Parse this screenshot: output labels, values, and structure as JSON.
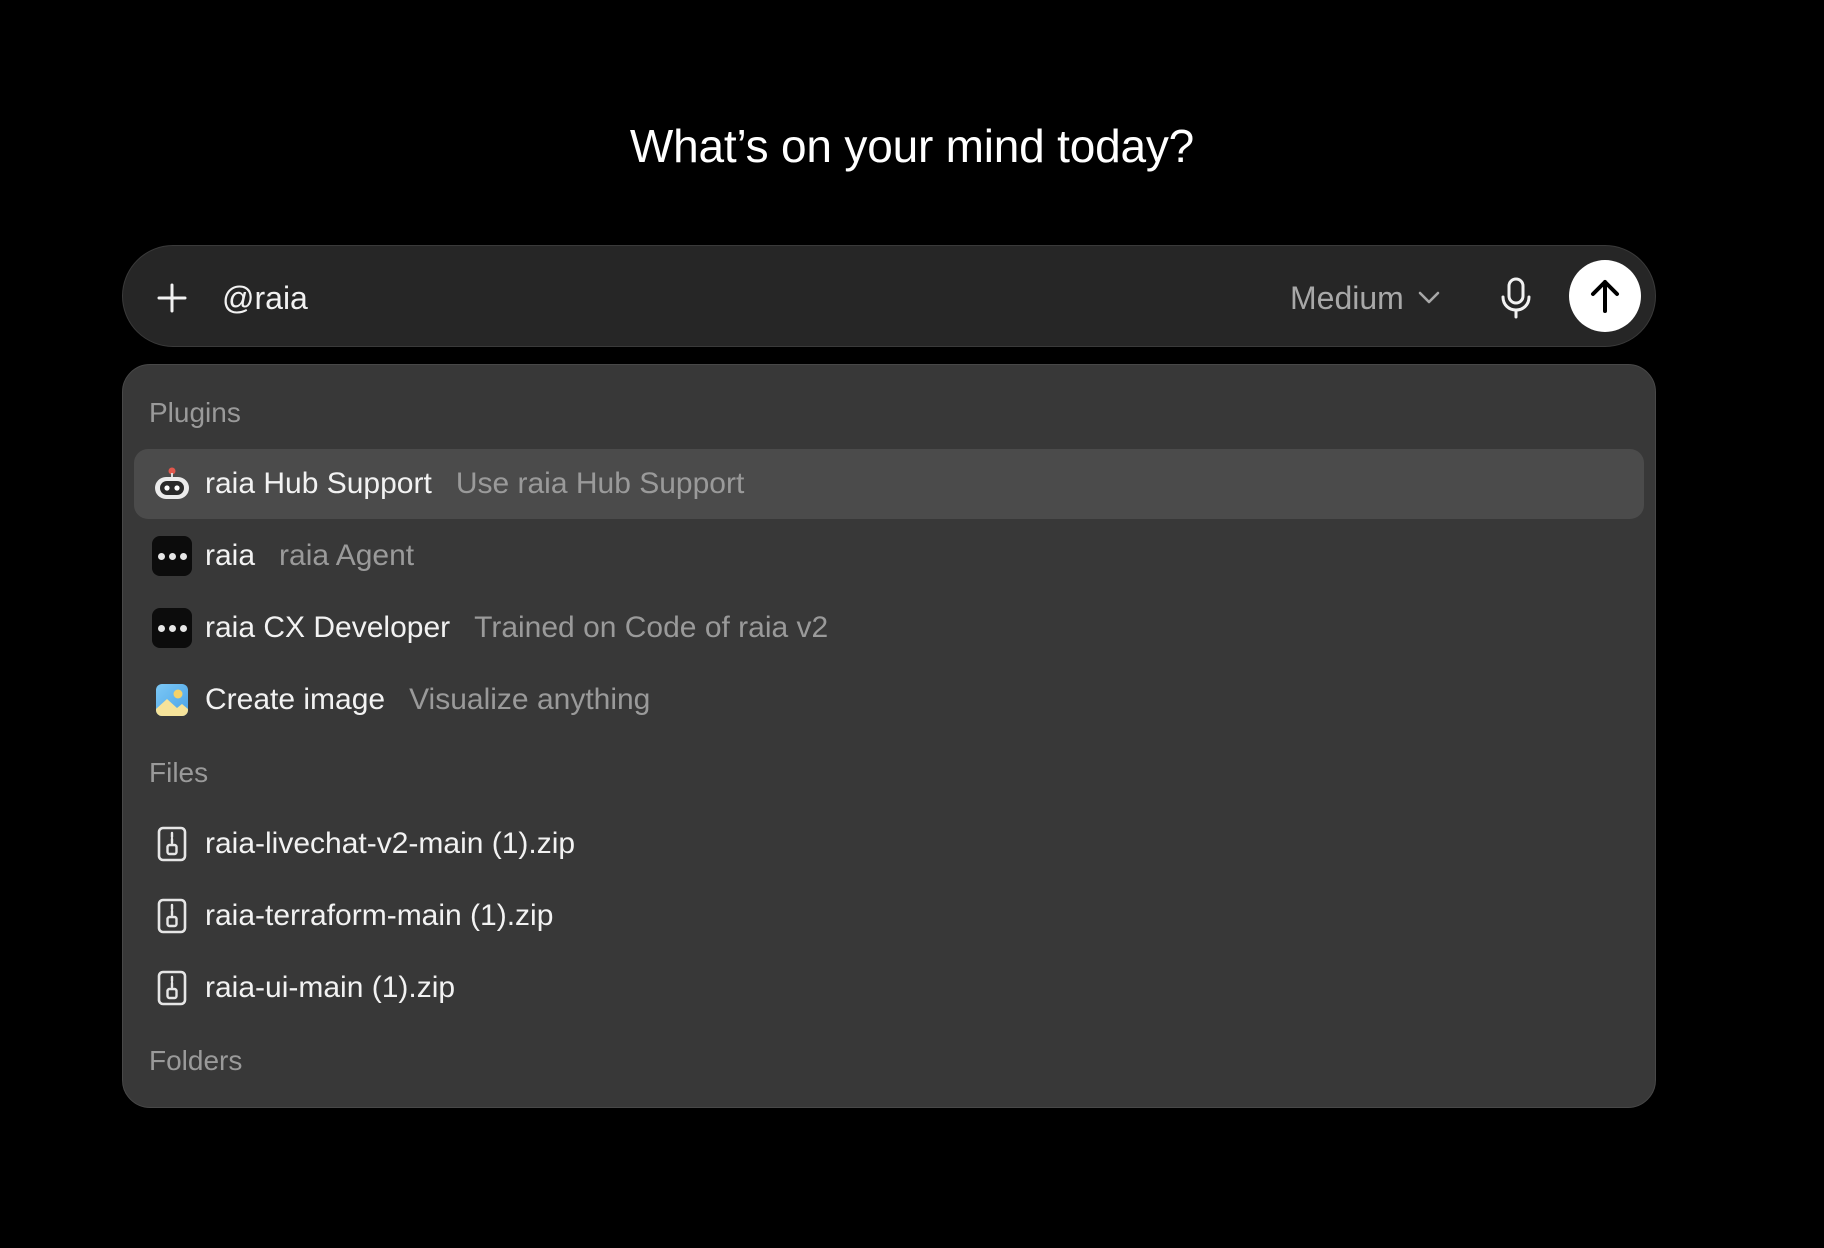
{
  "headline": "What’s on your mind today?",
  "composer": {
    "input_value": "@raia",
    "model_label": "Medium",
    "icons": {
      "add": "plus-icon",
      "model_dropdown": "chevron-down-icon",
      "voice": "microphone-icon",
      "send": "arrow-up-icon"
    }
  },
  "dropdown": {
    "sections": {
      "plugins": "Plugins",
      "files": "Files",
      "folders": "Folders"
    },
    "plugins": [
      {
        "title": "raia Hub Support",
        "description": "Use raia Hub Support",
        "icon": "robot-icon",
        "selected": true
      },
      {
        "title": "raia",
        "description": "raia Agent",
        "icon": "three-dots-icon",
        "selected": false
      },
      {
        "title": "raia CX Developer",
        "description": "Trained on Code of raia v2",
        "icon": "three-dots-icon",
        "selected": false
      },
      {
        "title": "Create image",
        "description": "Visualize anything",
        "icon": "image-icon",
        "selected": false
      }
    ],
    "files": [
      {
        "name": "raia-livechat-v2-main (1).zip",
        "icon": "zip-file-icon"
      },
      {
        "name": "raia-terraform-main (1).zip",
        "icon": "zip-file-icon"
      },
      {
        "name": "raia-ui-main (1).zip",
        "icon": "zip-file-icon"
      }
    ]
  },
  "colors": {
    "background": "#000000",
    "composer": "#262626",
    "dropdown": "#383838",
    "selected_row": "#4b4b4b",
    "muted_text": "#9a9a9a",
    "send_button": "#ffffff"
  }
}
